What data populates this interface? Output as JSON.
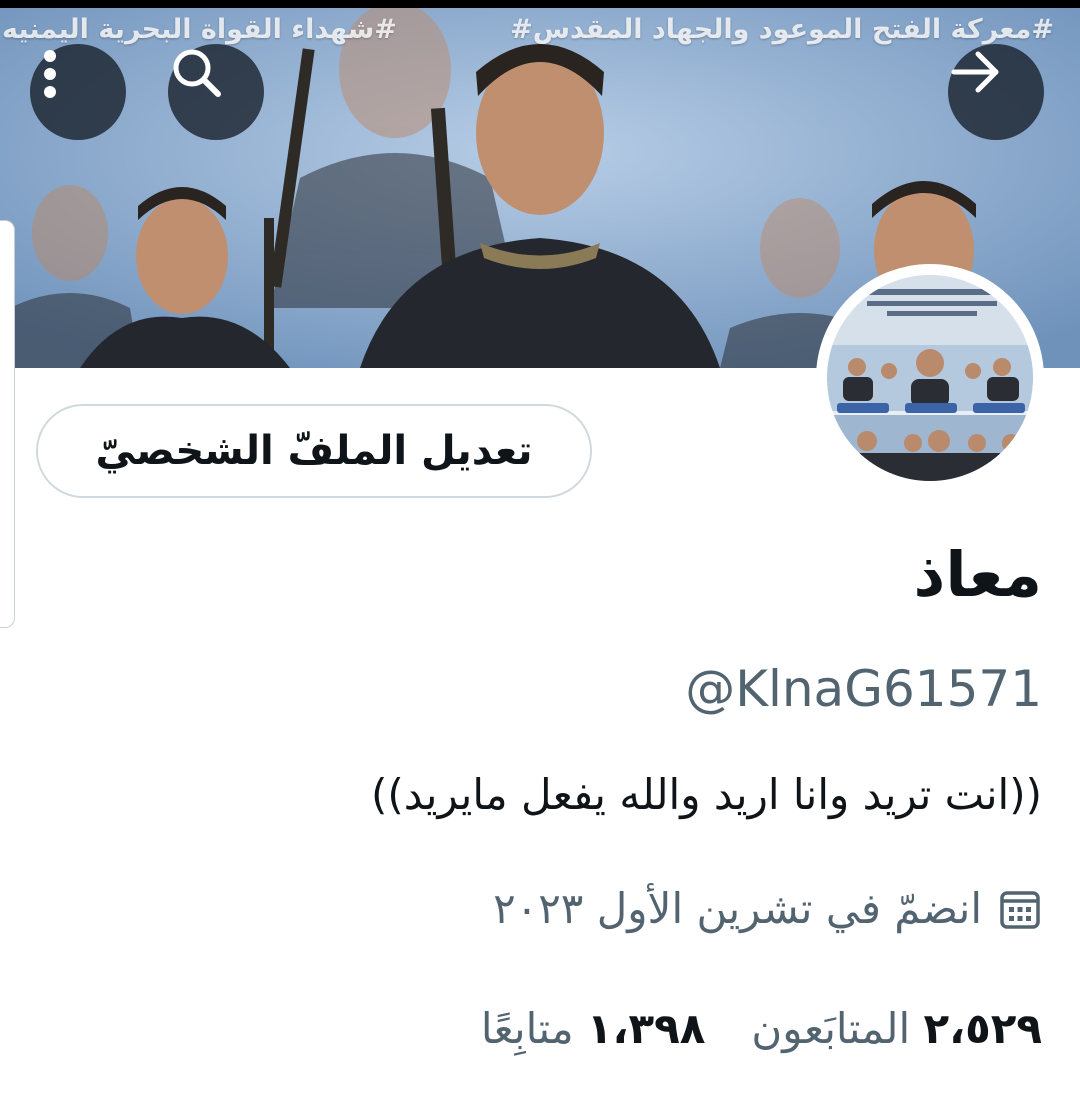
{
  "banner": {
    "hashtag_left": "#شهداء القواة البحرية اليمنيه",
    "hashtag_right": "#معركة الفتح الموعود والجهاد المقدس#"
  },
  "top_bar": {
    "more_icon": "more-vertical-icon",
    "search_icon": "search-icon",
    "forward_icon": "arrow-right-icon"
  },
  "profile": {
    "edit_button_label": "تعديل الملفّ الشخصيّ",
    "display_name": "معاذ",
    "handle": "@KlnaG61571",
    "bio": "((انت تريد وانا اريد والله يفعل مايريد))",
    "joined_text": "انضمّ في تشرين الأول ٢٠٢٣",
    "calendar_icon": "calendar-icon"
  },
  "stats": {
    "followers_count": "٢،٥٢٩",
    "followers_label": "المتابَعون",
    "following_count": "١،٣٩٨",
    "following_label": "متابِعًا"
  },
  "colors": {
    "text_primary": "#0f1419",
    "text_secondary": "#536471",
    "button_border": "#cfd9de",
    "overlay_button": "#161e28"
  }
}
